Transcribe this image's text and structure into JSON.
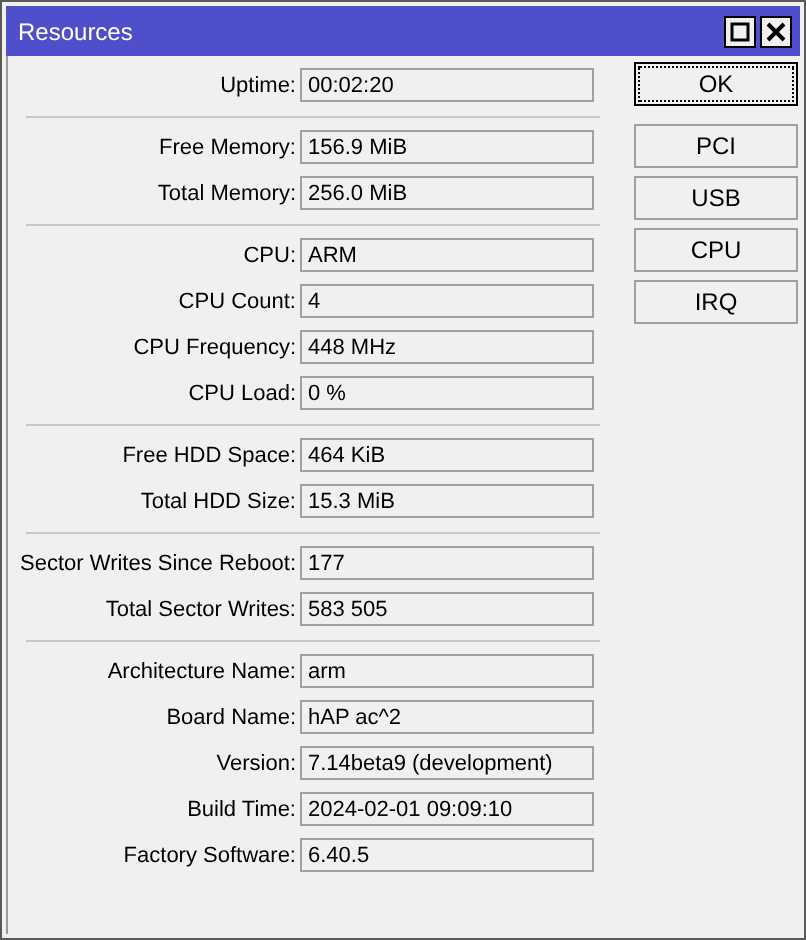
{
  "window": {
    "title": "Resources"
  },
  "groups": [
    [
      {
        "label": "Uptime:",
        "value": "00:02:20"
      }
    ],
    [
      {
        "label": "Free Memory:",
        "value": "156.9 MiB"
      },
      {
        "label": "Total Memory:",
        "value": "256.0 MiB"
      }
    ],
    [
      {
        "label": "CPU:",
        "value": "ARM"
      },
      {
        "label": "CPU Count:",
        "value": "4"
      },
      {
        "label": "CPU Frequency:",
        "value": "448 MHz"
      },
      {
        "label": "CPU Load:",
        "value": "0 %"
      }
    ],
    [
      {
        "label": "Free HDD Space:",
        "value": "464 KiB"
      },
      {
        "label": "Total HDD Size:",
        "value": "15.3 MiB"
      }
    ],
    [
      {
        "label": "Sector Writes Since Reboot:",
        "value": "177"
      },
      {
        "label": "Total Sector Writes:",
        "value": "583 505"
      }
    ],
    [
      {
        "label": "Architecture Name:",
        "value": "arm"
      },
      {
        "label": "Board Name:",
        "value": "hAP ac^2"
      },
      {
        "label": "Version:",
        "value": "7.14beta9 (development)"
      },
      {
        "label": "Build Time:",
        "value": "2024-02-01 09:09:10"
      },
      {
        "label": "Factory Software:",
        "value": "6.40.5"
      }
    ]
  ],
  "buttons": [
    {
      "label": "OK",
      "focused": true
    },
    {
      "label": "PCI",
      "focused": false
    },
    {
      "label": "USB",
      "focused": false
    },
    {
      "label": "CPU",
      "focused": false
    },
    {
      "label": "IRQ",
      "focused": false
    }
  ]
}
